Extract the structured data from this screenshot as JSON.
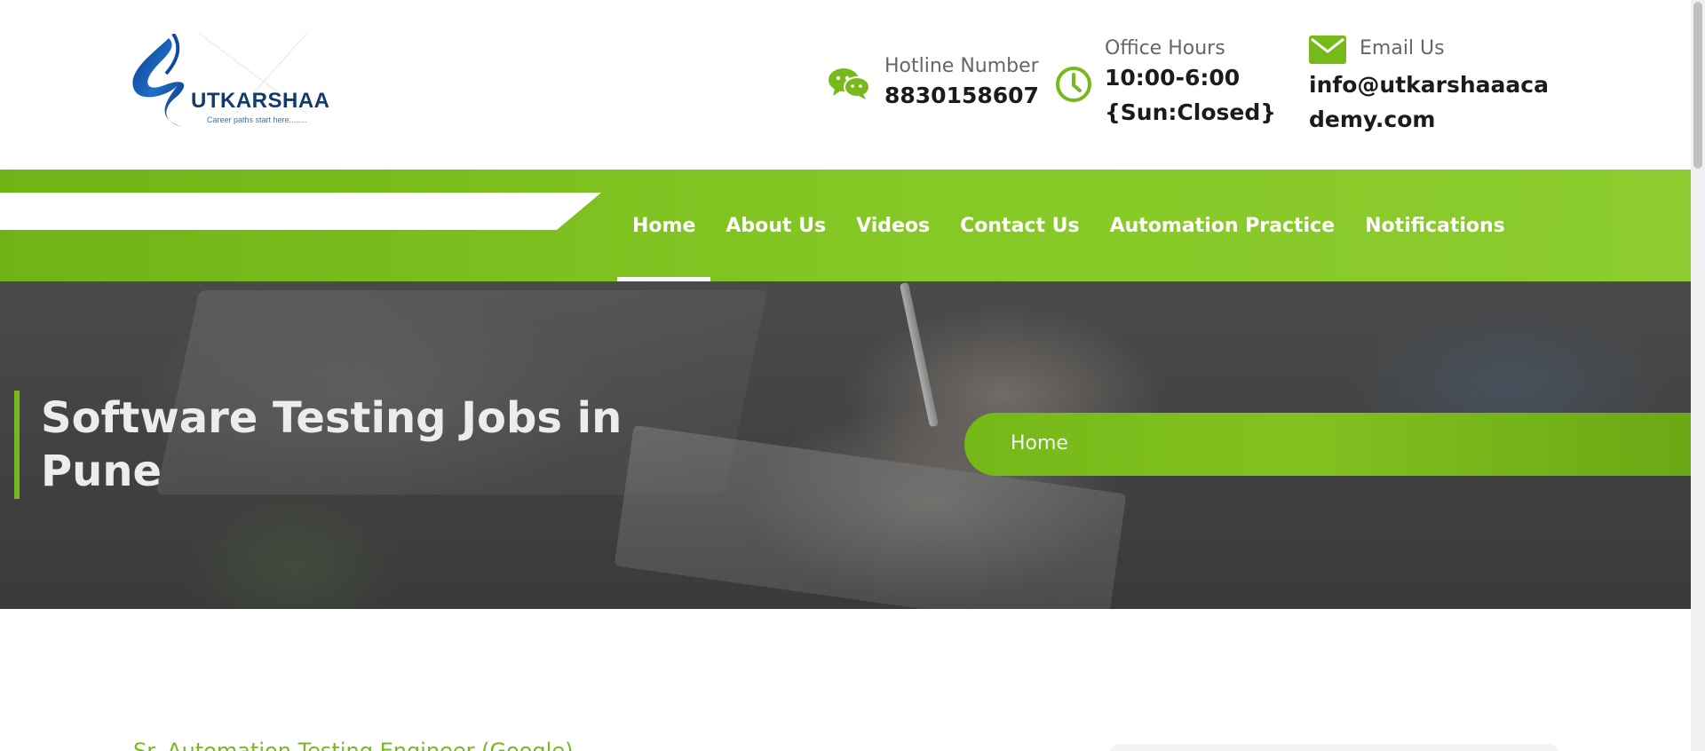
{
  "header": {
    "logo": {
      "wordmark": "UTKARSHAA",
      "tagline": "Career paths start here........"
    },
    "hotline": {
      "label": "Hotline Number",
      "value": "8830158607",
      "icon": "chat-bubbles-icon"
    },
    "office_hours": {
      "label": "Office Hours",
      "line1": "10:00-6:00",
      "line2": "{Sun:Closed}",
      "icon": "clock-icon"
    },
    "email": {
      "label": "Email Us",
      "line1": "info@utkarshaaaca",
      "line2": "demy.com",
      "icon": "envelope-icon"
    }
  },
  "nav": {
    "items": [
      {
        "label": "Home",
        "active": true
      },
      {
        "label": "About Us"
      },
      {
        "label": "Videos"
      },
      {
        "label": "Contact Us"
      },
      {
        "label": "Automation Practice"
      },
      {
        "label": "Notifications"
      }
    ]
  },
  "hero": {
    "title": "Software Testing Jobs in Pune",
    "breadcrumb": "Home"
  },
  "content": {
    "first_heading": "Sr. Automation Testing Engineer (Google)"
  },
  "colors": {
    "accent_green": "#76b91a",
    "wordmark_navy": "#123a6b",
    "hero_text": "#ececec"
  }
}
